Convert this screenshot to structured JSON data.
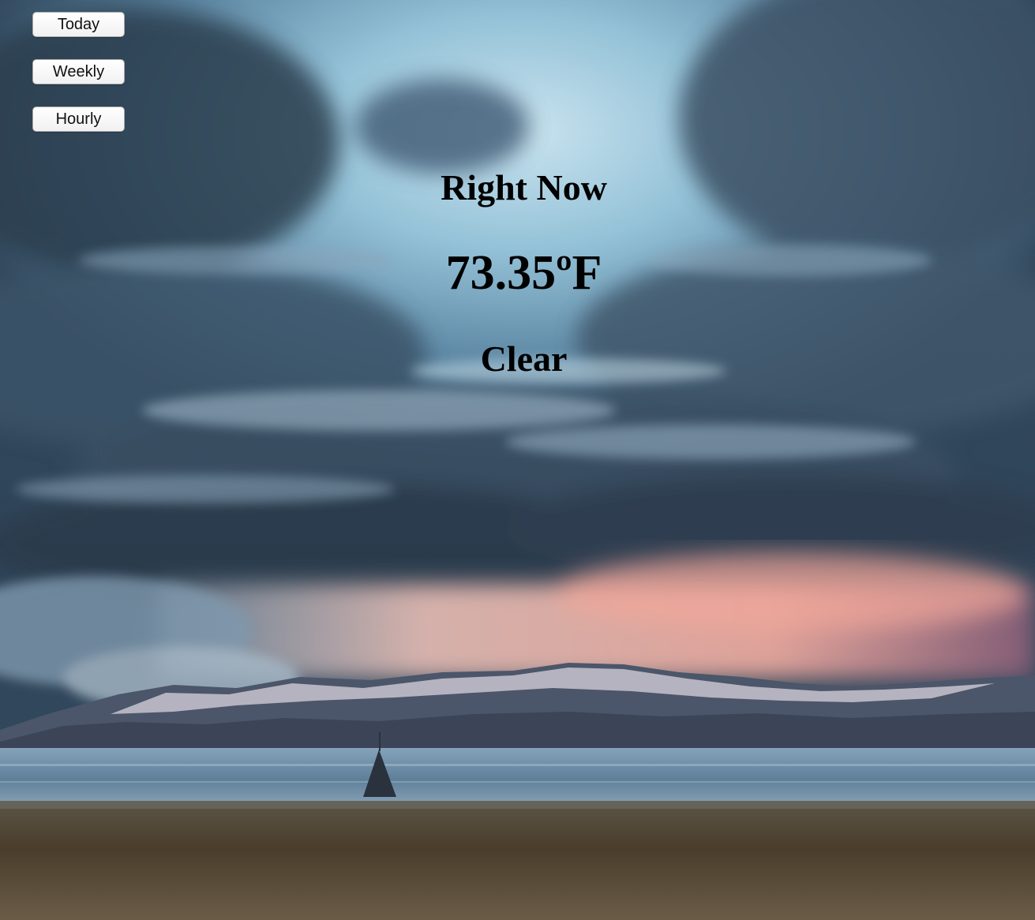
{
  "nav": {
    "today_label": "Today",
    "weekly_label": "Weekly",
    "hourly_label": "Hourly"
  },
  "current": {
    "heading": "Right Now",
    "temperature": "73.35ºF",
    "condition": "Clear"
  },
  "background": {
    "subject": "stormy-sky-over-mountains-and-lake",
    "colors": {
      "sky_light": "#b9dceb",
      "cloud_dark": "#33465a",
      "sunset_glow": "#f0b0a4",
      "lake": "#6d8ea8",
      "shore": "#4e4330"
    }
  }
}
